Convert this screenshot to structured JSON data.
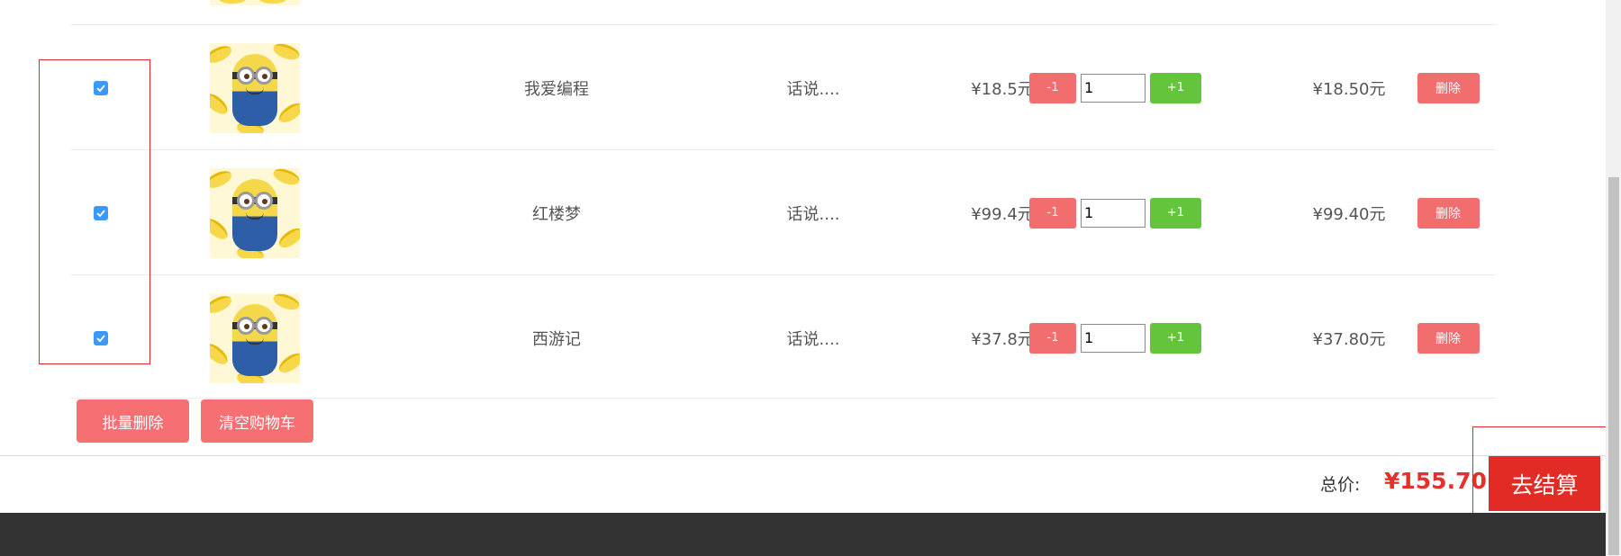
{
  "cart": {
    "items": [
      {
        "name": "我爱编程",
        "desc": "话说....",
        "price": "¥18.5元",
        "qty": "1",
        "subtotal": "¥18.50元",
        "minus": "-1",
        "plus": "+1",
        "delete": "删除",
        "checked": true
      },
      {
        "name": "红楼梦",
        "desc": "话说....",
        "price": "¥99.4元",
        "qty": "1",
        "subtotal": "¥99.40元",
        "minus": "-1",
        "plus": "+1",
        "delete": "删除",
        "checked": true
      },
      {
        "name": "西游记",
        "desc": "话说....",
        "price": "¥37.8元",
        "qty": "1",
        "subtotal": "¥37.80元",
        "minus": "-1",
        "plus": "+1",
        "delete": "删除",
        "checked": true
      }
    ],
    "actions": {
      "batch_delete": "批量删除",
      "clear_cart": "清空购物车"
    }
  },
  "summary": {
    "total_label": "总价:",
    "total_value": "¥155.70",
    "checkout": "去结算"
  },
  "colors": {
    "accent_red": "#e22b24",
    "button_red": "#f26d6e",
    "button_green": "#64c43c",
    "checkbox_blue": "#3b99fc",
    "annotation_red": "#e2262a"
  }
}
